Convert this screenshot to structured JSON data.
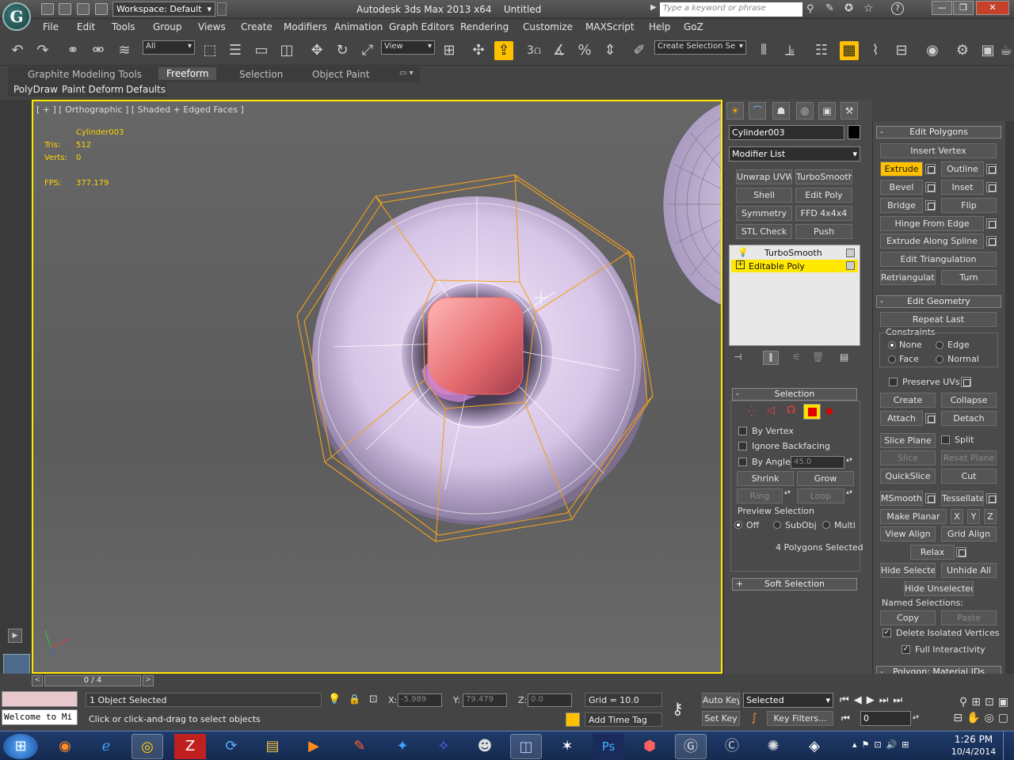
{
  "titlebar": {
    "app_logo": "G",
    "workspace": "Workspace: Default",
    "title": "Autodesk 3ds Max 2013 x64",
    "doc": "Untitled",
    "search_placeholder": "Type a keyword or phrase",
    "help": "?",
    "minimize": "—",
    "maximize": "❐",
    "close": "✕"
  },
  "menu": [
    "File",
    "Edit",
    "Tools",
    "Group",
    "Views",
    "Create",
    "Modifiers",
    "Animation",
    "Graph Editors",
    "Rendering",
    "Customize",
    "MAXScript",
    "Help",
    "GoZ"
  ],
  "toolbar": {
    "filter_select": "All",
    "ref_coord": "View",
    "create_selection": "Create Selection Se",
    "snap_label": "3"
  },
  "ribbon": {
    "tabs": [
      "Graphite Modeling Tools",
      "Freeform",
      "Selection",
      "Object Paint"
    ],
    "active_tab": "Freeform",
    "subtabs": [
      "PolyDraw",
      "Paint Deform",
      "Defaults"
    ]
  },
  "viewport": {
    "label": "[ + ] [ Orthographic ] [ Shaded + Edged Faces ]",
    "object_name": "Cylinder003",
    "tris_label": "Tris:",
    "tris_value": "512",
    "verts_label": "Verts:",
    "verts_value": "0",
    "fps_label": "FPS:",
    "fps_value": "377.179"
  },
  "command_panel": {
    "object_name": "Cylinder003",
    "modifier_list": "Modifier List",
    "modifier_buttons": [
      "Unwrap UVW",
      "TurboSmooth",
      "Shell",
      "Edit Poly",
      "Symmetry",
      "FFD 4x4x4",
      "STL Check",
      "Push"
    ],
    "stack": [
      {
        "name": "TurboSmooth",
        "selected": false
      },
      {
        "name": "Editable Poly",
        "selected": true
      }
    ],
    "selection": {
      "title": "Selection",
      "by_vertex": "By Vertex",
      "ignore_backfacing": "Ignore Backfacing",
      "by_angle": "By Angle:",
      "angle_value": "45.0",
      "shrink": "Shrink",
      "grow": "Grow",
      "ring": "Ring",
      "loop": "Loop",
      "preview_selection": "Preview Selection",
      "preview_options": [
        "Off",
        "SubObj",
        "Multi"
      ],
      "status": "4 Polygons Selected"
    },
    "soft_selection": "Soft Selection"
  },
  "edit_polygons": {
    "title": "Edit Polygons",
    "insert_vertex": "Insert Vertex",
    "extrude": "Extrude",
    "outline": "Outline",
    "bevel": "Bevel",
    "inset": "Inset",
    "bridge": "Bridge",
    "flip": "Flip",
    "hinge_from_edge": "Hinge From Edge",
    "extrude_along_spline": "Extrude Along Spline",
    "edit_triangulation": "Edit Triangulation",
    "retriangulate": "Retriangulate",
    "turn": "Turn"
  },
  "edit_geometry": {
    "title": "Edit Geometry",
    "repeat_last": "Repeat Last",
    "constraints": "Constraints",
    "none": "None",
    "edge": "Edge",
    "face": "Face",
    "normal": "Normal",
    "preserve_uvs": "Preserve UVs",
    "create": "Create",
    "collapse": "Collapse",
    "attach": "Attach",
    "detach": "Detach",
    "slice_plane": "Slice Plane",
    "split": "Split",
    "slice": "Slice",
    "reset_plane": "Reset Plane",
    "quickslice": "QuickSlice",
    "cut": "Cut",
    "msmooth": "MSmooth",
    "tessellate": "Tessellate",
    "make_planar": "Make Planar",
    "x": "X",
    "y": "Y",
    "z": "Z",
    "view_align": "View Align",
    "grid_align": "Grid Align",
    "relax": "Relax",
    "hide_selected": "Hide Selected",
    "unhide_all": "Unhide All",
    "hide_unselected": "Hide Unselected",
    "named_selections": "Named Selections:",
    "copy": "Copy",
    "paste": "Paste",
    "delete_isolated": "Delete Isolated Vertices",
    "full_interactivity": "Full Interactivity",
    "polygon_material_ids": "Polygon: Material IDs"
  },
  "status": {
    "timeline": "0 / 4",
    "objects_selected": "1 Object Selected",
    "prompt": "Click or click-and-drag to select objects",
    "x_label": "X:",
    "x_value": "-5.989",
    "y_label": "Y:",
    "y_value": "79.479",
    "z_label": "Z:",
    "z_value": "0.0",
    "grid": "Grid = 10.0",
    "add_time_tag": "Add Time Tag",
    "auto_key": "Auto Key",
    "set_key": "Set Key",
    "selected": "Selected",
    "key_filters": "Key Filters...",
    "frame": "0",
    "welcome": "Welcome to Mi"
  },
  "taskbar": {
    "time": "1:26 PM",
    "date": "10/4/2014"
  },
  "colors": {
    "selection_orange": "#f0a020",
    "viewport_border": "#ffe800",
    "highlight": "#ffc000"
  }
}
